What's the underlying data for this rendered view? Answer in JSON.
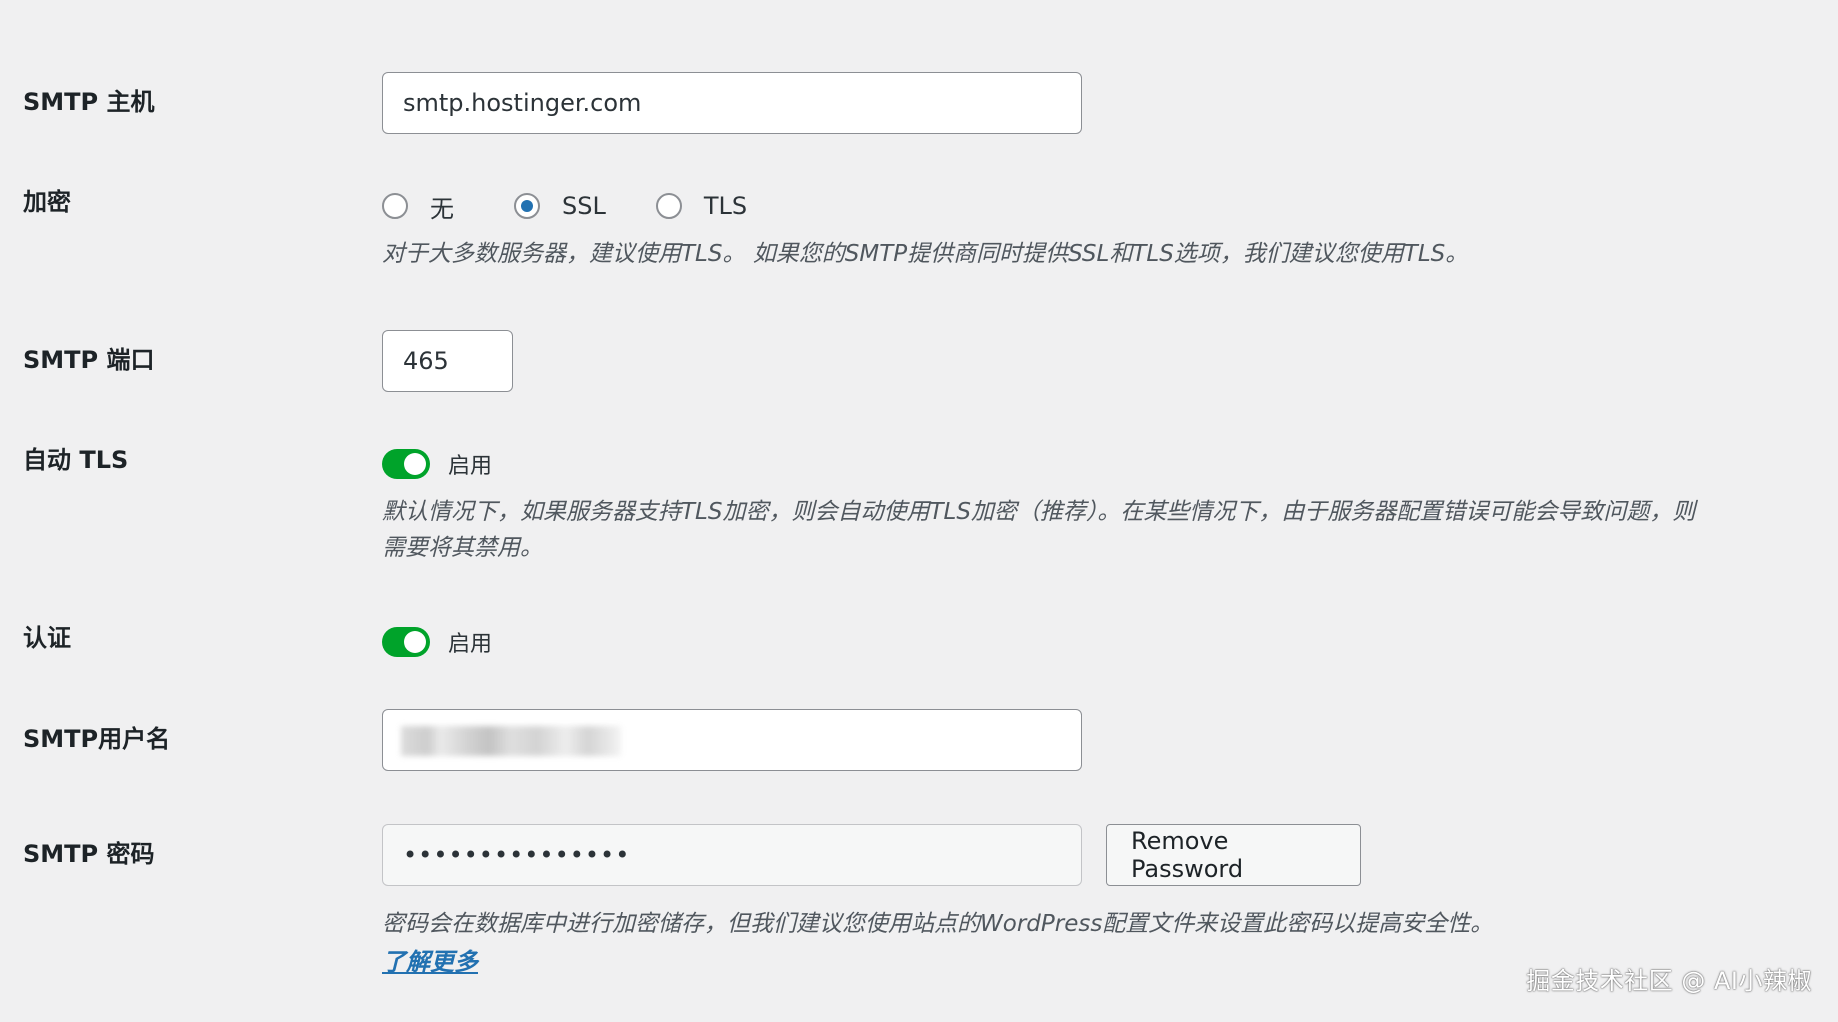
{
  "smtp_host": {
    "label": "SMTP 主机",
    "value": "smtp.hostinger.com"
  },
  "encryption": {
    "label": "加密",
    "options": [
      "无",
      "SSL",
      "TLS"
    ],
    "selected": "SSL",
    "description": "对于大多数服务器，建议使用TLS。 如果您的SMTP提供商同时提供SSL和TLS选项，我们建议您使用TLS。"
  },
  "smtp_port": {
    "label": "SMTP 端口",
    "value": "465"
  },
  "auto_tls": {
    "label": "自动 TLS",
    "toggle_label": "启用",
    "enabled": true,
    "description_line1": "默认情况下，如果服务器支持TLS加密，则会自动使用TLS加密（推荐）。在某些情况下，由于服务器配置错误可能会导致问题，则",
    "description_line2": "需要将其禁用。"
  },
  "authentication": {
    "label": "认证",
    "toggle_label": "启用",
    "enabled": true
  },
  "smtp_username": {
    "label": "SMTP用户名"
  },
  "smtp_password": {
    "label": "SMTP 密码",
    "value": "•••••••••••••••",
    "remove_button": "Remove Password",
    "description": "密码会在数据库中进行加密储存，但我们建议您使用站点的WordPress配置文件来设置此密码以提高安全性。",
    "learn_more": "了解更多"
  },
  "watermark": "掘金技术社区 @ AI小辣椒",
  "colors": {
    "background": "#f0f0f1",
    "accent": "#2271b1",
    "toggle_on": "#00a32a"
  }
}
